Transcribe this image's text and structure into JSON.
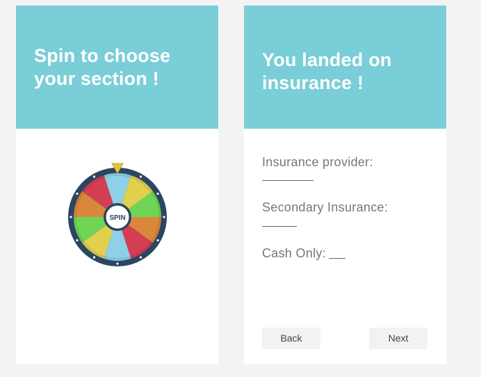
{
  "left_screen": {
    "title": "Spin to choose your section !",
    "wheel": {
      "center_label": "SPIN",
      "segment_colors": [
        "#8dd0e8",
        "#e1cf4e",
        "#6fd655",
        "#d9883b",
        "#d43e52",
        "#8dd0e8",
        "#e1cf4e",
        "#6fd655",
        "#d9883b",
        "#d43e52"
      ],
      "rim_color": "#2b4563",
      "pointer_color": "#e8c23a"
    }
  },
  "right_screen": {
    "title": "You landed on insurance !",
    "fields": {
      "insurance_provider": "Insurance provider:",
      "secondary_insurance": "Secondary Insurance:",
      "cash_only": "Cash Only:"
    },
    "buttons": {
      "back": "Back",
      "next": "Next"
    }
  },
  "colors": {
    "header": "#79ced8",
    "background": "#f3f3f3"
  }
}
